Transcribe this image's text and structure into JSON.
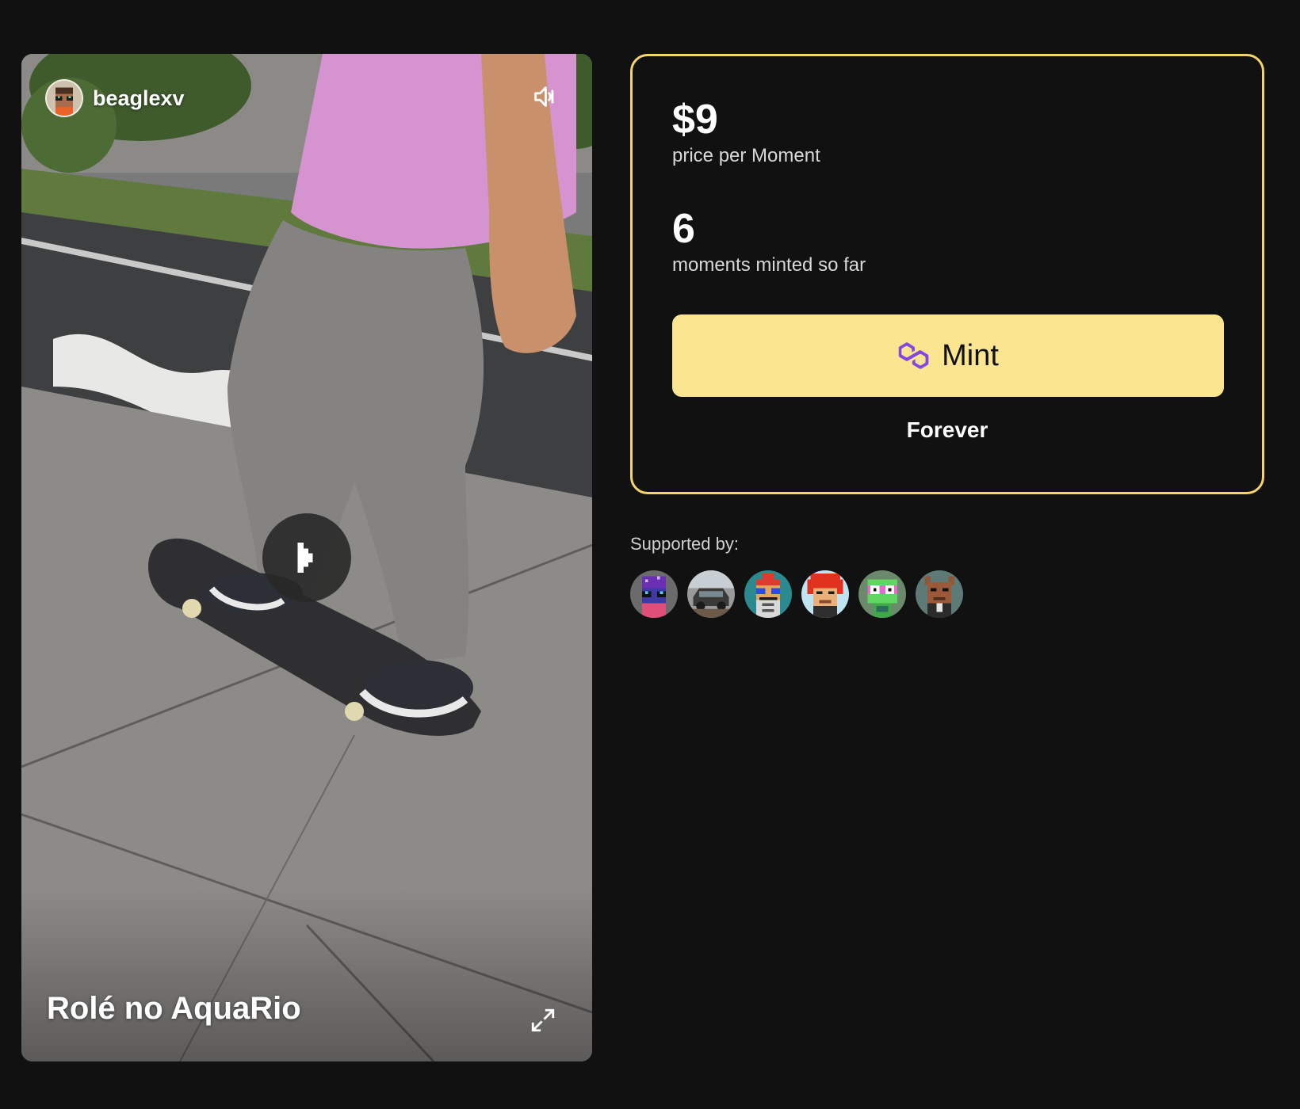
{
  "video": {
    "creator": {
      "name": "beaglexv",
      "avatar_icon": "pixel-avatar-icon"
    },
    "title": "Rolé no AquaRio",
    "controls": {
      "mute_icon": "speaker-icon",
      "play_icon": "play-icon",
      "fullscreen_icon": "expand-icon"
    }
  },
  "mint_card": {
    "price": {
      "value": "$9",
      "label": "price per Moment"
    },
    "minted": {
      "value": "6",
      "label": "moments minted so far"
    },
    "mint_button": {
      "label": "Mint",
      "icon": "polygon-icon"
    },
    "duration_label": "Forever",
    "colors": {
      "border": "#f7d46a",
      "button_bg": "#fce591",
      "polygon_icon": "#8247e5"
    }
  },
  "supported": {
    "label": "Supported by:",
    "supporters": [
      {
        "icon": "pixel-avatar-purple-icon",
        "bg": "#6b6b6b"
      },
      {
        "icon": "car-photo-icon",
        "bg": "#8a8a8a"
      },
      {
        "icon": "pixel-avatar-robot-icon",
        "bg": "#2a8a8f"
      },
      {
        "icon": "pixel-avatar-redhair-icon",
        "bg": "#bfe3f0"
      },
      {
        "icon": "pixel-avatar-green-icon",
        "bg": "#6b8a6b"
      },
      {
        "icon": "pixel-avatar-brown-icon",
        "bg": "#5e7a76"
      }
    ]
  }
}
